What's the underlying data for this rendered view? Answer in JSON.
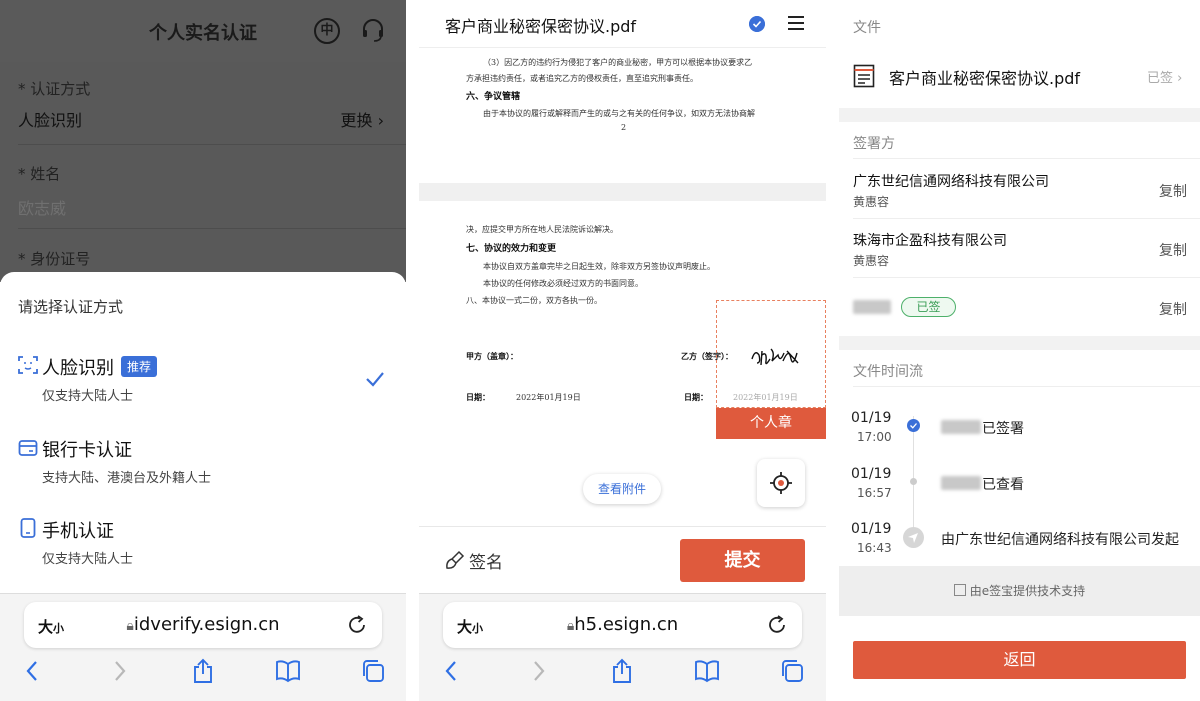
{
  "panel1": {
    "title": "个人实名认证",
    "lang_label": "中",
    "form": {
      "method_label": "* 认证方式",
      "method_value": "人脸识别",
      "change_link": "更换",
      "name_label": "* 姓名",
      "name_value": "欧志威",
      "id_label": "* 身份证号"
    },
    "sheet": {
      "title": "请选择认证方式",
      "options": [
        {
          "label": "人脸识别",
          "badge": "推荐",
          "sub": "仅支持大陆人士",
          "selected": true,
          "icon": "face-scan-icon"
        },
        {
          "label": "银行卡认证",
          "sub": "支持大陆、港澳台及外籍人士",
          "icon": "bank-card-icon"
        },
        {
          "label": "手机认证",
          "sub": "仅支持大陆人士",
          "icon": "phone-icon"
        }
      ]
    },
    "browser": {
      "size_label": "大",
      "size_small": "小",
      "url": "idverify.esign.cn"
    }
  },
  "panel2": {
    "title": "客户商业秘密保密协议.pdf",
    "doc": {
      "l1": "（3）因乙方的违约行为侵犯了客户的商业秘密，甲方可以根据本协议要求乙",
      "l2": "方承担违约责任，或者追究乙方的侵权责任，直至追究刑事责任。",
      "h6": "六、争议管辖",
      "l3": "由于本协议的履行或解释而产生的或与之有关的任何争议，如双方无法协商解",
      "page_no": "2",
      "l4": "决，应提交甲方所在地人民法院诉讼解决。",
      "h7": "七、协议的效力和变更",
      "l5": "本协议自双方盖章完毕之日起生效，除非双方另签协议声明废止。",
      "l6": "本协议的任何修改必须经过双方的书面同意。",
      "l7": "八、本协议一式二份，双方各执一份。",
      "party_a": "甲方（盖章）：",
      "party_b": "乙方（签字）：",
      "date_label_a": "日期：",
      "date_a": "2022年01月19日",
      "date_label_b": "日期：",
      "date_b": "2022年01月19日"
    },
    "seal_button": "个人章",
    "attach_button": "查看附件",
    "sign_label": "签名",
    "submit_button": "提交",
    "browser": {
      "size_label": "大",
      "size_small": "小",
      "url": "h5.esign.cn"
    }
  },
  "panel3": {
    "file_section": "文件",
    "file_name": "客户商业秘密保密协议.pdf",
    "file_status": "已签",
    "signers_section": "签署方",
    "signers": [
      {
        "org": "广东世纪信通网络科技有限公司",
        "person": "黄惠容",
        "copy": "复制"
      },
      {
        "org": "珠海市企盈科技有限公司",
        "person": "黄惠容",
        "copy": "复制"
      }
    ],
    "third_signer": {
      "badge": "已签",
      "copy": "复制"
    },
    "timeline_section": "文件时间流",
    "timeline": [
      {
        "date": "01/19",
        "time": "17:00",
        "text": "已签署"
      },
      {
        "date": "01/19",
        "time": "16:57",
        "text": "已查看"
      },
      {
        "date": "01/19",
        "time": "16:43",
        "text": "由广东世纪信通网络科技有限公司发起"
      }
    ],
    "powered_by": "由e签宝提供技术支持",
    "back_button": "返回"
  },
  "colors": {
    "accent": "#df5a3d",
    "blue": "#3a6fd8",
    "green": "#3a9d56"
  }
}
